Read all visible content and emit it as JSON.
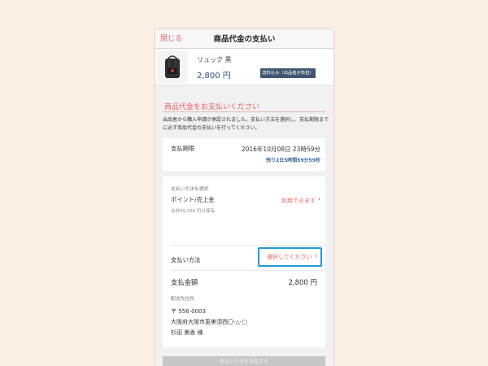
{
  "nav": {
    "close_label": "閉じる",
    "title": "商品代金の支払い"
  },
  "product": {
    "name": "リュック 黒",
    "price": "2,800 円",
    "shipping_badge": "送料込み（出品者が負担）",
    "thumbnail_icon": "backpack-icon"
  },
  "payment_notice": {
    "title": "商品代金をお支払いください",
    "description": "出品者から購入申請が承認されました。支払い方法を選択し、支払期限までに必ず商品代金の支払いを行ってください。"
  },
  "deadline": {
    "label": "支払期限",
    "date": "2016年10月08日 23時59分",
    "remaining": "残り2日5時間59分59秒"
  },
  "payment_method": {
    "section_label": "支払い方法を選択",
    "points_label": "ポイント/売上金",
    "points_total": "合計69,256 円分保有",
    "points_link": "利用できます",
    "method_label": "支払い方法",
    "method_select": "選択してください",
    "total_label": "支払金額",
    "total_value": "2,800 円"
  },
  "address": {
    "section_label": "配送先住所",
    "postal": "〒 556-0003",
    "line1": "大阪府大阪市恵美須西〇-△-□",
    "name": "杉田 美香 様"
  },
  "submit_label": "支払い方法を決定する",
  "colors": {
    "accent_red": "#e8605f",
    "navy": "#3f5770",
    "highlight_blue": "#1e9ad6",
    "background": "#fbeee2"
  }
}
